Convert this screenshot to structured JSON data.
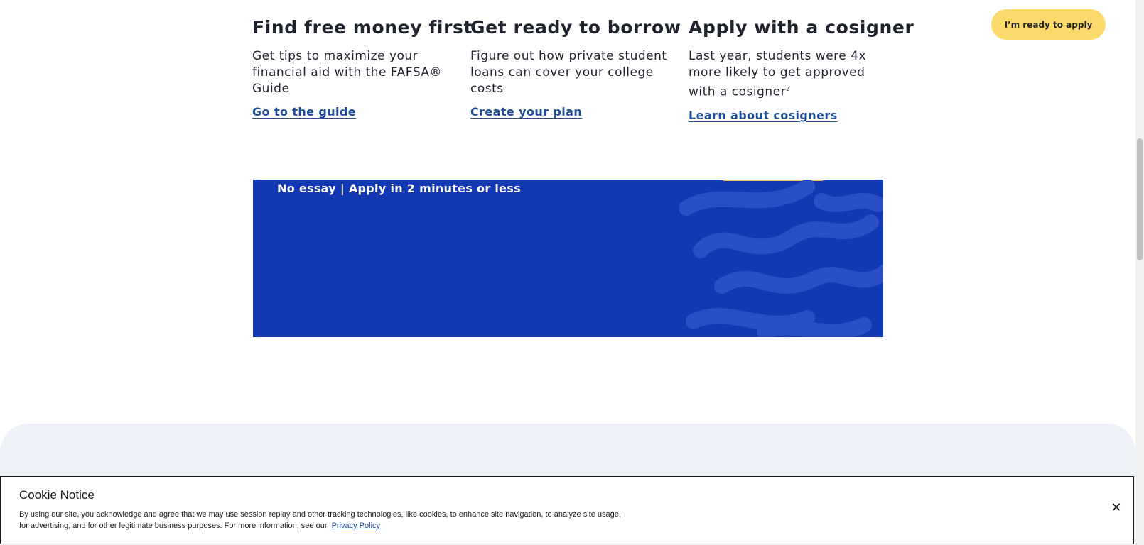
{
  "columns": [
    {
      "heading": "Find free money first",
      "text": "Get tips to maximize your financial aid with the FAFSA® Guide",
      "sup": "",
      "link": "Go to the guide"
    },
    {
      "heading": "Get ready to borrow",
      "text": "Figure out how private student loans can cover your college costs",
      "sup": "",
      "link": "Create your plan"
    },
    {
      "heading": "Apply with a cosigner",
      "text": "Last year, students were 4x more likely to get approved with a cosigner",
      "sup": "2",
      "link": "Learn about cosigners"
    }
  ],
  "cta_label": "I’m ready to apply",
  "banner": {
    "tagline": "No essay | Apply in 2 minutes or less"
  },
  "cookie": {
    "title": "Cookie Notice",
    "body": "By using our site, you acknowledge and agree that we may use session replay and other tracking technologies, like cookies, to enhance site navigation, to analyze site usage, for advertising, and for other legitimate business purposes. For more information, see our",
    "link": "Privacy Policy",
    "close": "✕"
  },
  "colors": {
    "banner_blue": "#1338b4",
    "cta_yellow": "#fbd96b",
    "link_blue": "#1d4f9a"
  }
}
